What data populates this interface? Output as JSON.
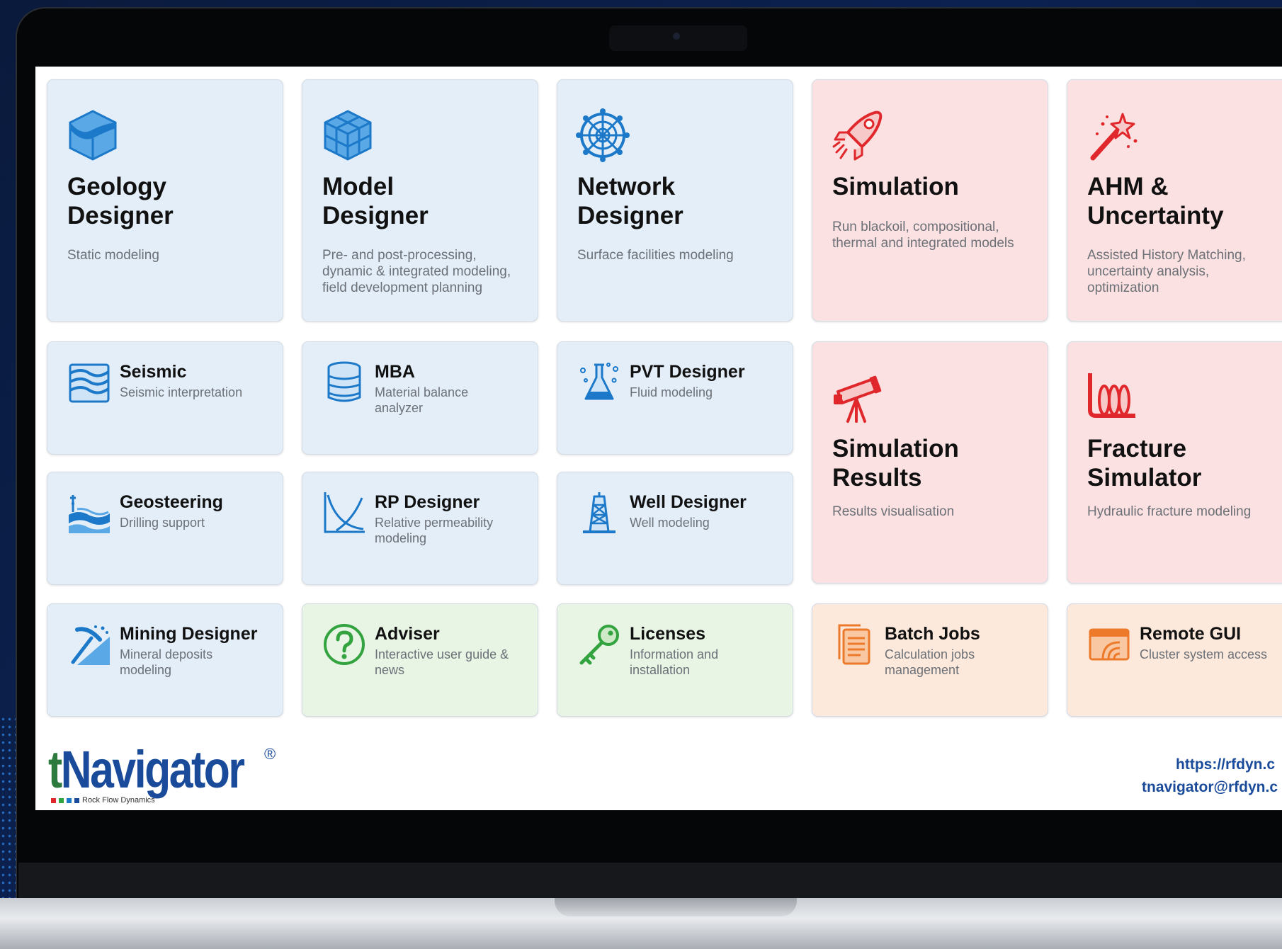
{
  "tiles": {
    "geology": {
      "title_line1": "Geology",
      "title_line2": "Designer",
      "desc": "Static modeling"
    },
    "model": {
      "title_line1": "Model",
      "title_line2": "Designer",
      "desc_line1": "Pre- and post-processing,",
      "desc_line2": "dynamic & integrated modeling,",
      "desc_line3": "field development planning"
    },
    "network": {
      "title_line1": "Network",
      "title_line2": "Designer",
      "desc": "Surface facilities modeling"
    },
    "simulation": {
      "title": "Simulation",
      "desc_line1": "Run blackoil, compositional,",
      "desc_line2": "thermal and integrated models"
    },
    "ahm": {
      "title_line1": "AHM &",
      "title_line2": "Uncertainty",
      "desc_line1": "Assisted History Matching,",
      "desc_line2": "uncertainty analysis,",
      "desc_line3": "optimization"
    },
    "seismic": {
      "title": "Seismic",
      "desc": "Seismic interpretation"
    },
    "mba": {
      "title": "MBA",
      "desc_line1": "Material balance",
      "desc_line2": "analyzer"
    },
    "pvt": {
      "title": "PVT Designer",
      "desc": "Fluid modeling"
    },
    "sim_results": {
      "title_line1": "Simulation",
      "title_line2": "Results",
      "desc": "Results visualisation"
    },
    "fracture": {
      "title_line1": "Fracture",
      "title_line2": "Simulator",
      "desc": "Hydraulic fracture modeling"
    },
    "geosteering": {
      "title": "Geosteering",
      "desc": "Drilling support"
    },
    "rp": {
      "title": "RP Designer",
      "desc_line1": "Relative permeability",
      "desc_line2": "modeling"
    },
    "well": {
      "title": "Well Designer",
      "desc": "Well modeling"
    },
    "mining": {
      "title": "Mining Designer",
      "desc_line1": "Mineral deposits",
      "desc_line2": "modeling"
    },
    "adviser": {
      "title": "Adviser",
      "desc_line1": "Interactive user guide &",
      "desc_line2": "news"
    },
    "licenses": {
      "title": "Licenses",
      "desc_line1": "Information and",
      "desc_line2": "installation"
    },
    "batch": {
      "title": "Batch Jobs",
      "desc_line1": "Calculation jobs",
      "desc_line2": "management"
    },
    "remote": {
      "title": "Remote GUI",
      "desc": "Cluster system access"
    }
  },
  "logo": {
    "t": "t",
    "name": "Navigator",
    "reg": "®",
    "sub": "Rock Flow Dynamics"
  },
  "links": {
    "website": "https://rfdyn.c",
    "email": "tnavigator@rfdyn.c"
  },
  "colors": {
    "blue_icon": "#1c78c8",
    "red_icon": "#e0282c",
    "green_icon": "#33a33f",
    "orange_icon": "#ec7a2a",
    "blue_card": "#e3eef9",
    "pink_card": "#fbe1e1",
    "green_card": "#e8f5e5",
    "peach_card": "#fde9dc"
  },
  "icons": [
    "geology-cube-icon",
    "model-cube-icon",
    "network-globe-icon",
    "rocket-icon",
    "magic-wand-icon",
    "seismic-layers-icon",
    "database-icon",
    "flask-icon",
    "telescope-icon",
    "fracture-icon",
    "geosteering-icon",
    "relative-permeability-chart-icon",
    "drilling-rig-icon",
    "pickaxe-icon",
    "question-icon",
    "key-icon",
    "document-icon",
    "remote-wifi-icon"
  ]
}
